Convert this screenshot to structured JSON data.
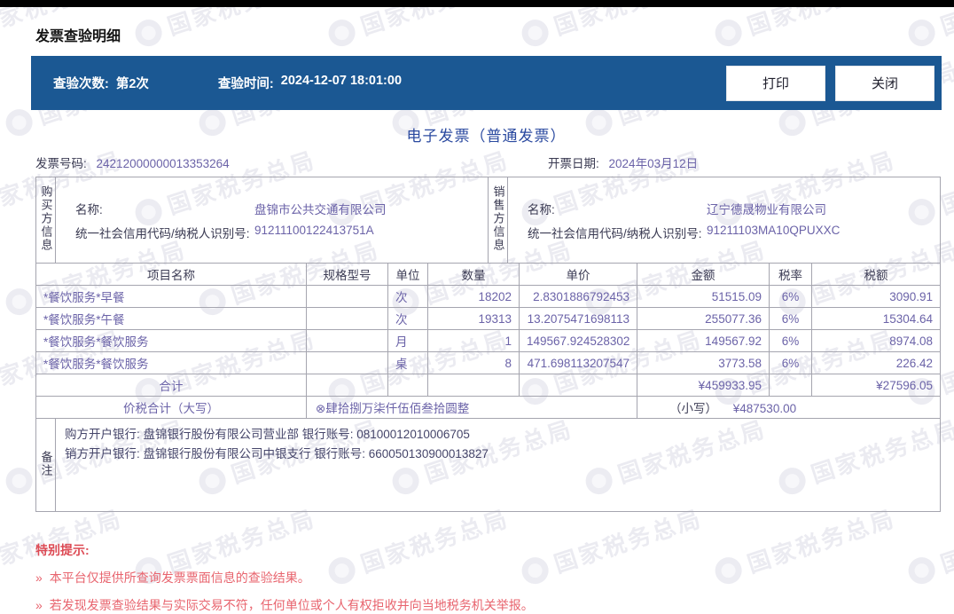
{
  "page": {
    "title": "发票查验明细",
    "watermark_text": "国家税务总局"
  },
  "toolbar": {
    "check_count_label": "查验次数:",
    "check_count_value": "第2次",
    "check_time_label": "查验时间:",
    "check_time_value": "2024-12-07 18:01:00",
    "print_label": "打印",
    "close_label": "关闭"
  },
  "invoice": {
    "type_title": "电子发票（普通发票）",
    "number_label": "发票号码:",
    "number": "24212000000013353264",
    "date_label": "开票日期:",
    "date": "2024年03月12日",
    "buyer": {
      "side_label": "购买方信息",
      "name_label": "名称:",
      "name": "盘锦市公共交通有限公司",
      "taxid_label": "统一社会信用代码/纳税人识别号:",
      "taxid": "91211100122413751A"
    },
    "seller": {
      "side_label": "销售方信息",
      "name_label": "名称:",
      "name": "辽宁德晟物业有限公司",
      "taxid_label": "统一社会信用代码/纳税人识别号:",
      "taxid": "91211103MA10QPUXXC"
    },
    "items_table": {
      "headers": [
        "项目名称",
        "规格型号",
        "单位",
        "数量",
        "单价",
        "金额",
        "税率",
        "税额"
      ],
      "rows": [
        {
          "name": "*餐饮服务*早餐",
          "spec": "",
          "unit": "次",
          "qty": "18202",
          "price": "2.8301886792453",
          "amount": "51515.09",
          "tax_rate": "6%",
          "tax": "3090.91"
        },
        {
          "name": "*餐饮服务*午餐",
          "spec": "",
          "unit": "次",
          "qty": "19313",
          "price": "13.2075471698113",
          "amount": "255077.36",
          "tax_rate": "6%",
          "tax": "15304.64"
        },
        {
          "name": "*餐饮服务*餐饮服务",
          "spec": "",
          "unit": "月",
          "qty": "1",
          "price": "149567.924528302",
          "amount": "149567.92",
          "tax_rate": "6%",
          "tax": "8974.08"
        },
        {
          "name": "*餐饮服务*餐饮服务",
          "spec": "",
          "unit": "桌",
          "qty": "8",
          "price": "471.698113207547",
          "amount": "3773.58",
          "tax_rate": "6%",
          "tax": "226.42"
        }
      ],
      "total_label": "合计",
      "total_amount": "¥459933.95",
      "total_tax": "¥27596.05"
    },
    "sum": {
      "label": "价税合计（大写）",
      "in_words": "⊗肆拾捌万柒仟伍佰叁拾圆整",
      "small_label": "（小写）",
      "small_value": "¥487530.00"
    },
    "remarks": {
      "side_label": "备注",
      "lines": [
        "购方开户银行: 盘锦银行股份有限公司营业部 银行账号: 08100012010006705",
        "销方开户银行: 盘锦银行股份有限公司中银支行 银行账号: 660050130900013827"
      ]
    }
  },
  "notice": {
    "title": "特别提示:",
    "bullet": "»",
    "items": [
      "本平台仅提供所查询发票票面信息的查验结果。",
      "若发现发票查验结果与实际交易不符，任何单位或个人有权拒收并向当地税务机关举报。"
    ]
  },
  "colors": {
    "top_band": "#000000",
    "toolbar_blue": "#1b5893",
    "invoice_title_blue": "#2b4aa0",
    "value_purple": "#6b63a8",
    "label_dark": "#3a3a52",
    "table_border_gray": "#a5a5af",
    "notice_red": "#e4565f",
    "watermark_gray": "#ebebf1"
  }
}
